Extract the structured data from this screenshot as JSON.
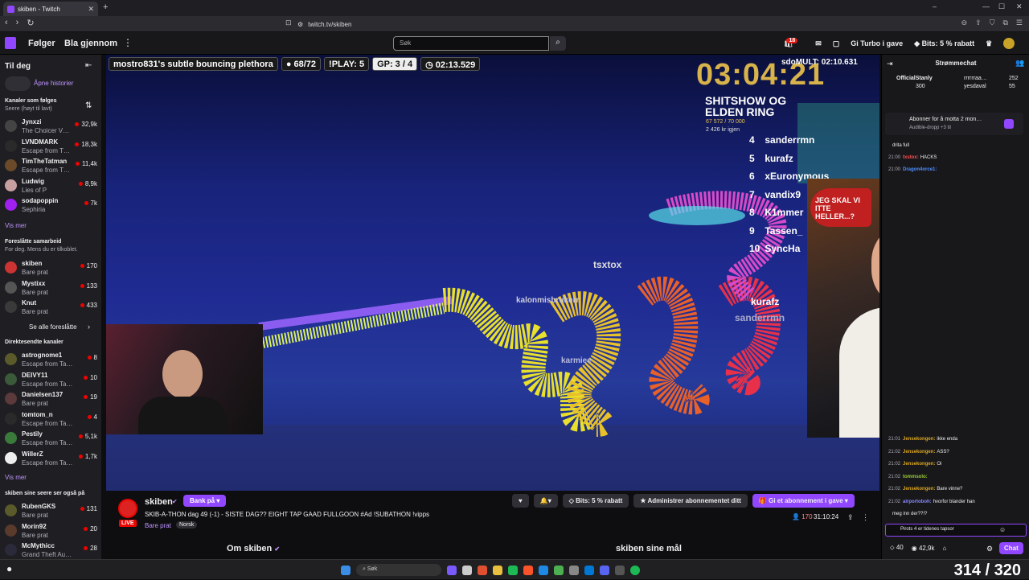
{
  "browser": {
    "tab_title": "skiben - Twitch",
    "url": "twitch.tv/skiben"
  },
  "topnav": {
    "following": "Følger",
    "browse": "Bla gjennom",
    "search_placeholder": "Søk",
    "notif_count": "18",
    "turbo": "Gi Turbo i gave",
    "bits": "Bits: 5 % rabatt"
  },
  "sidebar": {
    "for_you": "Til deg",
    "open_stories": "Åpne historier",
    "followed_title": "Kanaler som følges",
    "followed_sub": "Seere (høyt til lavt)",
    "followed": [
      {
        "name": "Jynxzi",
        "game": "The Choicer V…",
        "count": "32,9k",
        "color": "#444"
      },
      {
        "name": "LVNDMARK",
        "game": "Escape from T…",
        "count": "18,3k",
        "color": "#2a2a2a"
      },
      {
        "name": "TimTheTatman",
        "game": "Escape from T…",
        "count": "11,4k",
        "color": "#6b4a2a"
      },
      {
        "name": "Ludwig",
        "game": "Lies of P",
        "count": "8,9k",
        "color": "#c9a0a0"
      },
      {
        "name": "sodapoppin",
        "game": "Sephiria",
        "count": "7k",
        "color": "#a020f0"
      }
    ],
    "show_more": "Vis mer",
    "collab_title": "Foreslåtte samarbeid",
    "collab_sub": "For deg. Mens du er tilkoblet.",
    "collab": [
      {
        "name": "skiben",
        "game": "Bare prat",
        "count": "170",
        "color": "#c33"
      },
      {
        "name": "Mystixx",
        "game": "Bare prat",
        "count": "133",
        "color": "#555"
      },
      {
        "name": "Knut",
        "game": "Bare prat",
        "count": "433",
        "color": "#3a3a3a"
      }
    ],
    "see_all": "Se alle foreslåtte",
    "direct_title": "Direktesendte kanaler",
    "direct": [
      {
        "name": "astrognome1",
        "game": "Escape from Ta…",
        "count": "8",
        "color": "#5a5a2a"
      },
      {
        "name": "DEIVY11",
        "game": "Escape from Ta…",
        "count": "10",
        "color": "#3a5a3a"
      },
      {
        "name": "Danielsen137",
        "game": "Bare prat",
        "count": "19",
        "color": "#5a3a3a"
      },
      {
        "name": "tomtom_n",
        "game": "Escape from Ta…",
        "count": "4",
        "color": "#2a2a2a"
      },
      {
        "name": "Pestily",
        "game": "Escape from Ta…",
        "count": "5,1k",
        "color": "#3a7a3a"
      },
      {
        "name": "WillerZ",
        "game": "Escape from Ta…",
        "count": "1,7k",
        "color": "#eee"
      }
    ],
    "show_more2": "Vis mer",
    "also_title": "skiben sine seere ser også på",
    "also": [
      {
        "name": "RubenGKS",
        "game": "Bare prat",
        "count": "131",
        "color": "#5a5a2a"
      },
      {
        "name": "Morin92",
        "game": "Bare prat",
        "count": "20",
        "color": "#5a3a2a"
      },
      {
        "name": "McMythicc",
        "game": "Grand Theft Au…",
        "count": "28",
        "color": "#2a2a3a"
      }
    ]
  },
  "video": {
    "hud_title": "mostro831's subtle bouncing plethora",
    "hud_count": "68/72",
    "hud_play": "!PLAY: 5",
    "hud_gp": "GP: 3 / 4",
    "hud_time": "02:13.529",
    "big_timer": "03:04:21",
    "sdo": "sdoMULT: 02:10.631",
    "shitshow": "SHITSHOW OG ELDEN RING",
    "donation": "67 572 / 70 000",
    "donation2": "2 426 kr igjen",
    "leaderboard": [
      {
        "n": "4",
        "name": "sanderrmn"
      },
      {
        "n": "5",
        "name": "kurafz"
      },
      {
        "n": "6",
        "name": "xEuronymous"
      },
      {
        "n": "7",
        "name": "vandix9"
      },
      {
        "n": "8",
        "name": "K1mmer"
      },
      {
        "n": "9",
        "name": "Tassen_"
      },
      {
        "n": "10",
        "name": "SyncHa"
      }
    ],
    "float_tsxtox": "tsxtox",
    "float_kurafz": "kurafz",
    "float_sander": "sanderrmn",
    "float_kalon": "kalonmisbrukerr",
    "float_karmiee": "karmiee",
    "banner": "JEG SKAL VI ITTE HELLER...?"
  },
  "info": {
    "streamer": "skiben",
    "bank": "Bank på",
    "title": "SKIB-A-THON dag 49 (-1) - SISTE DAG?? EIGHT TAP GAAD FULLGOON #Ad !SUBATHON !vipps",
    "category": "Bare prat",
    "language": "Norsk",
    "bits_btn": "Bits: 5 % rabatt",
    "manage_sub": "Administrer abonnementet ditt",
    "gift_sub": "Gi et abonnement i gave",
    "viewers": "170",
    "uptime": "31:10:24",
    "about": "Om skiben",
    "goals": "skiben sine mål",
    "live": "LIVE"
  },
  "chat": {
    "header": "Strømmechat",
    "top_user": "OfficialStanly",
    "top_amount": "300",
    "top2_user": "rrrrrraa…",
    "top2_amount": "252",
    "top3_user": "yesdaval",
    "top3_amount": "55",
    "promo": "Abonner for å motta 2 mon…",
    "promo_sub": "Audible-dropp +3 til",
    "messages_top": [
      {
        "t": "",
        "u": "",
        "m": "drita full",
        "c": "#efeff1"
      },
      {
        "t": "21:00",
        "u": "txstox:",
        "m": "HACKS",
        "c": "#ff4f4f"
      },
      {
        "t": "21:00",
        "u": "Dragon4orce1:",
        "m": "",
        "c": "#4f8fff"
      }
    ],
    "messages_bottom": [
      {
        "t": "21:01",
        "u": "Jensekongen:",
        "m": "ikke enda",
        "c": "#daa520"
      },
      {
        "t": "21:02",
        "u": "Jensekongen:",
        "m": "ASS?",
        "c": "#daa520"
      },
      {
        "t": "21:02",
        "u": "Jensekongen:",
        "m": "Oi",
        "c": "#daa520"
      },
      {
        "t": "21:02",
        "u": "tommsolo:",
        "m": "",
        "c": "#9acd32"
      },
      {
        "t": "21:02",
        "u": "Jensekongen:",
        "m": "Bare vinne?",
        "c": "#daa520"
      },
      {
        "t": "21:02",
        "u": "airportoboh:",
        "m": "hvorfor blander han",
        "c": "#8a8aff"
      },
      {
        "t": "",
        "u": "",
        "m": "meg inn der??!?",
        "c": "#efeff1"
      }
    ],
    "input_value": "Pirots 4 er tidenes tapsor",
    "points": "40",
    "coins": "42,9k",
    "chat_btn": "Chat"
  },
  "taskbar": {
    "search": "Søk",
    "counter": "314 / 320"
  }
}
